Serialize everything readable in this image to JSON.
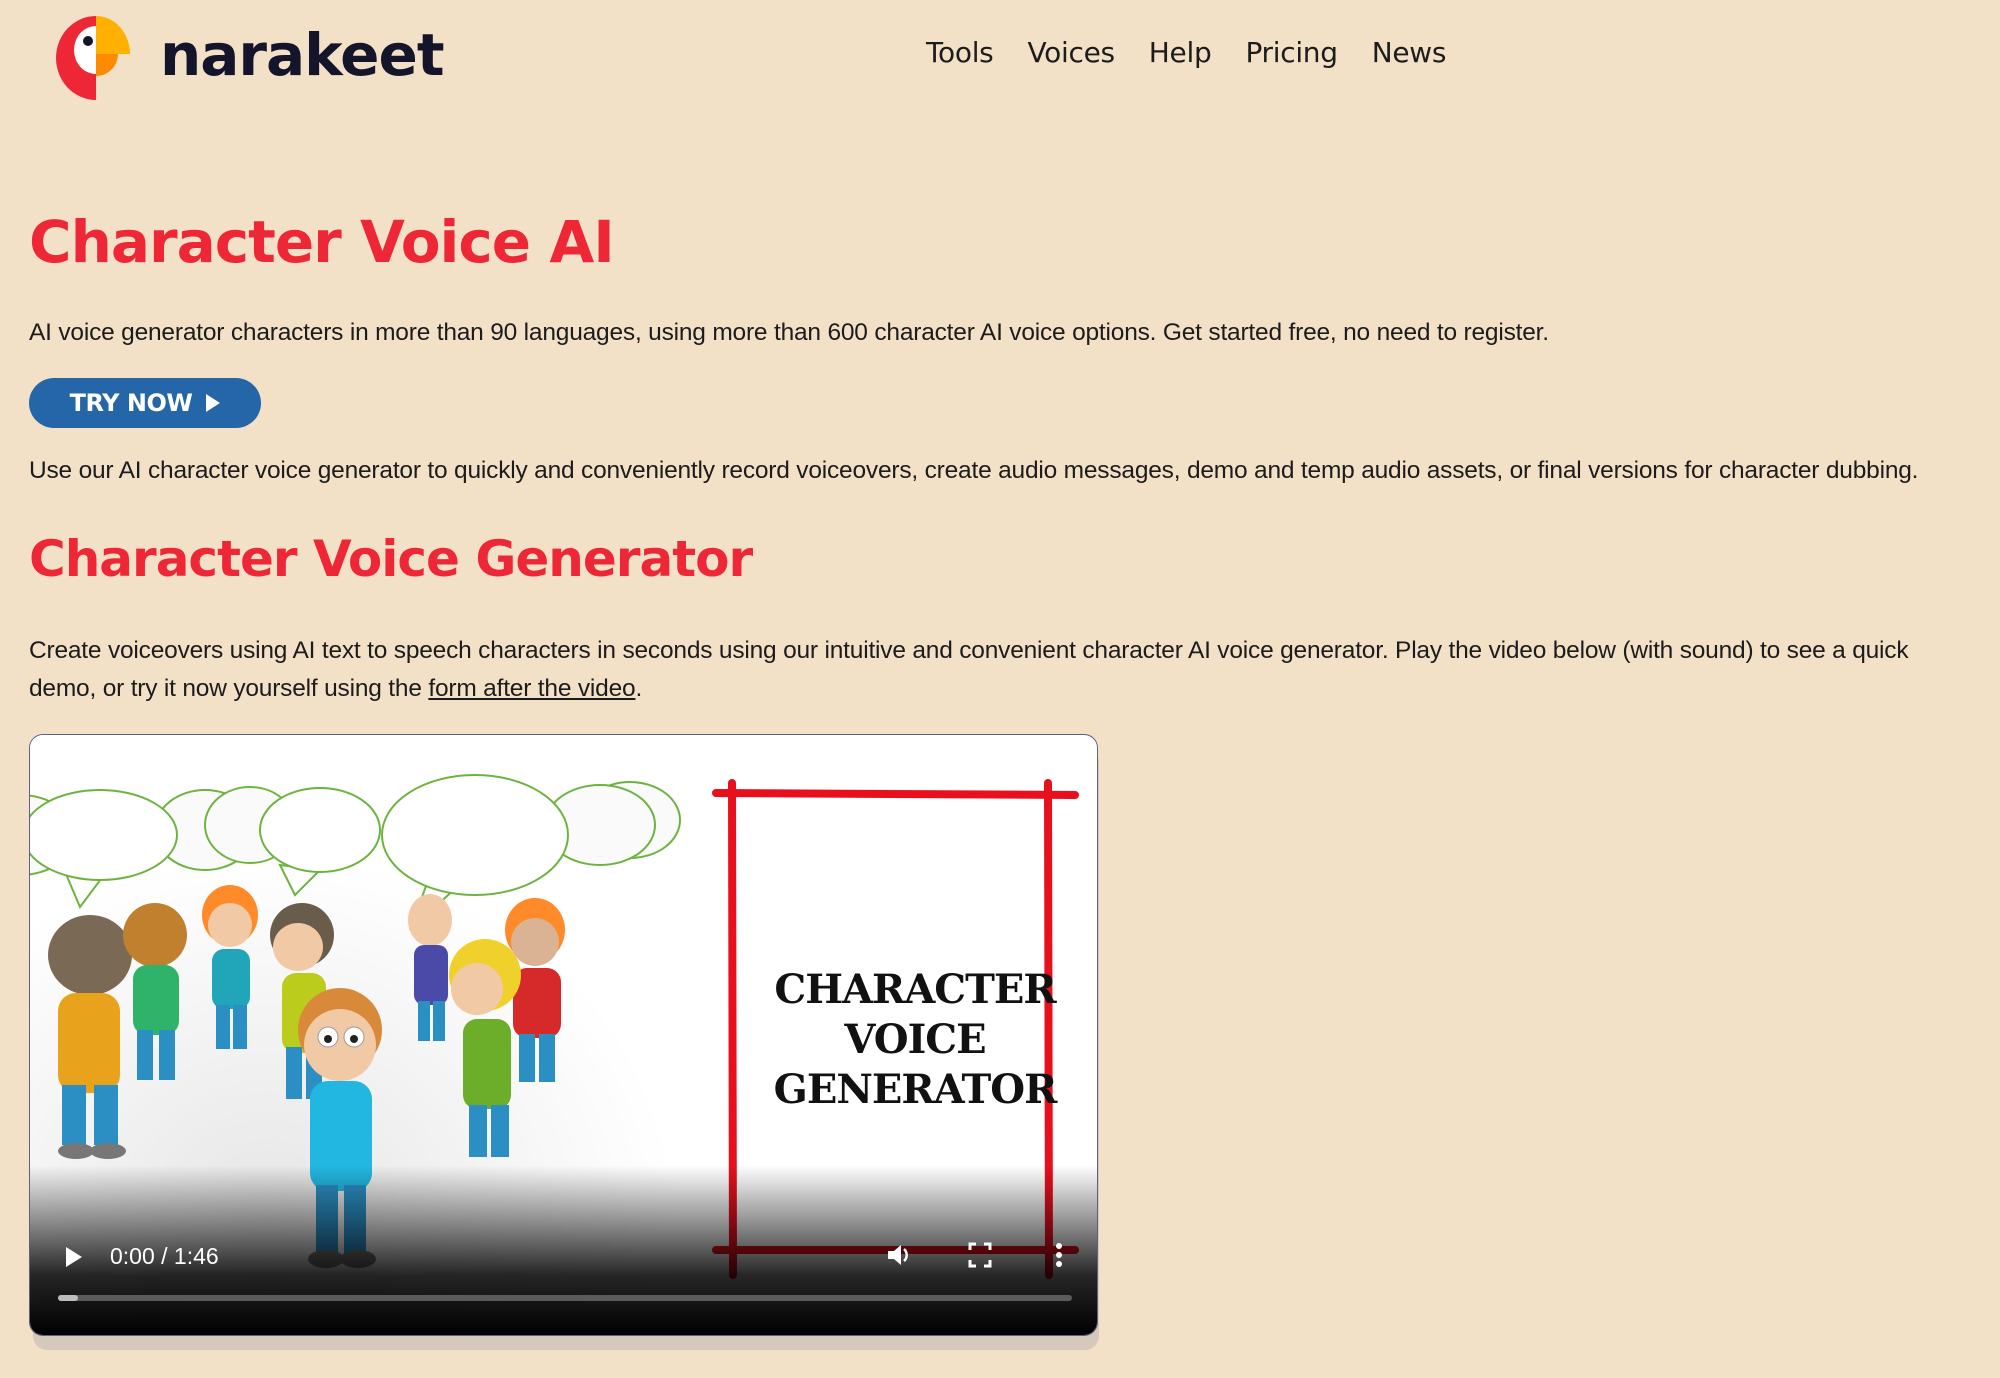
{
  "brand": {
    "name": "narakeet",
    "colors": {
      "background": "#F3E1C7",
      "accent_red": "#EE2737",
      "button_blue": "#2466A8",
      "logo_yellow": "#FFB000",
      "logo_orange": "#FF8A00",
      "text_dark": "#14142B"
    }
  },
  "nav": {
    "items": [
      {
        "label": "Tools"
      },
      {
        "label": "Voices"
      },
      {
        "label": "Help"
      },
      {
        "label": "Pricing"
      },
      {
        "label": "News"
      }
    ]
  },
  "hero": {
    "title": "Character Voice AI",
    "intro": "AI voice generator characters in more than 90 languages, using more than 600 character AI voice options. Get started free, no need to register.",
    "cta_label": "TRY NOW",
    "cta_icon": "play-icon",
    "description": "Use our AI character voice generator to quickly and conveniently record voiceovers, create audio messages, demo and temp audio assets, or final versions for character dubbing."
  },
  "section": {
    "title": "Character Voice Generator",
    "text_before_link": "Create voiceovers using AI text to speech characters in seconds using our intuitive and convenient character AI voice generator. Play the video below (with sound) to see a quick demo, or try it now yourself using the ",
    "link_text": "form after the video",
    "text_after_link": "."
  },
  "video": {
    "poster_title_lines": [
      "CHARACTER",
      "VOICE",
      "GENERATOR"
    ],
    "current_time": "0:00",
    "duration": "1:46",
    "time_display": "0:00 / 1:46",
    "progress_fraction": 0.02,
    "controls": {
      "play_icon": "play-icon",
      "volume_icon": "volume-icon",
      "fullscreen_icon": "fullscreen-icon",
      "more_icon": "more-vertical-icon"
    }
  }
}
